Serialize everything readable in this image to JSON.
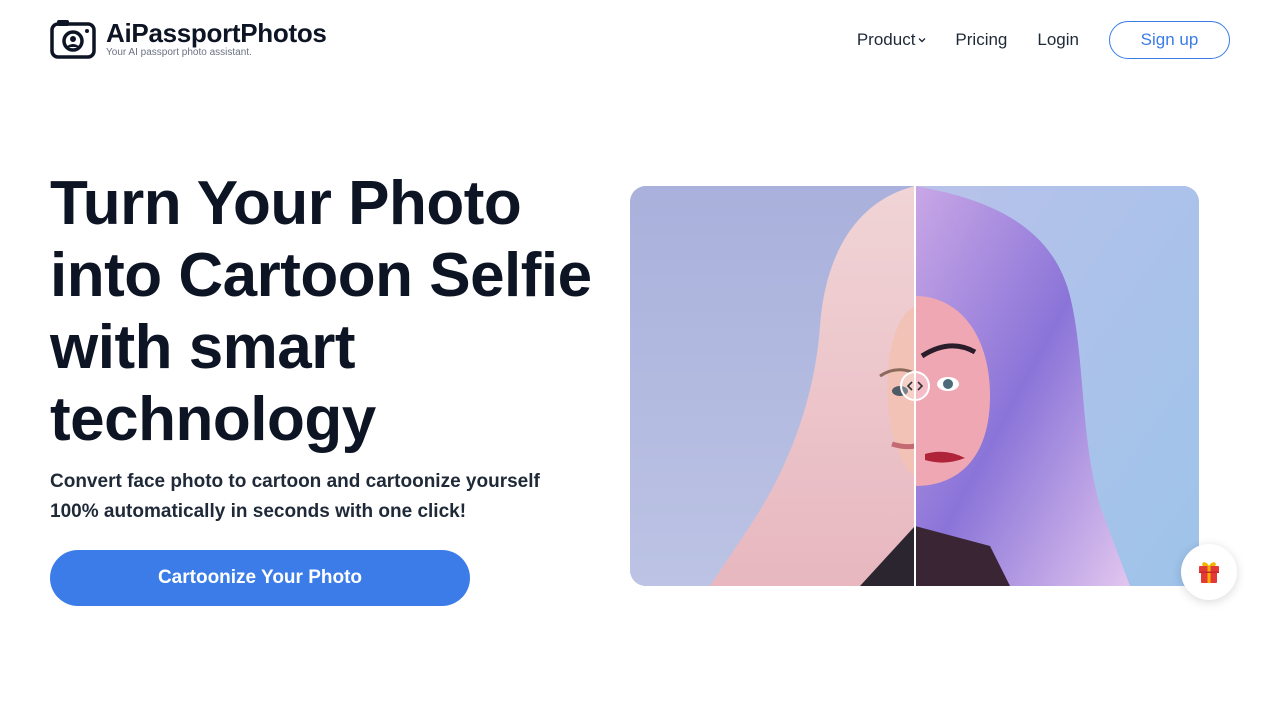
{
  "brand": {
    "name": "AiPassportPhotos",
    "tagline": "Your AI passport photo assistant."
  },
  "nav": {
    "product": "Product",
    "pricing": "Pricing",
    "login": "Login",
    "signup": "Sign up"
  },
  "hero": {
    "title": "Turn Your Photo into Cartoon Selfie with smart technology",
    "subtitle": "Convert face photo to cartoon and cartoonize yourself 100% automatically in seconds with one click!",
    "cta": "Cartoonize Your Photo"
  },
  "icons": {
    "logo": "camera-icon",
    "product_dropdown": "chevron-down-icon",
    "compare_handle": "left-right-arrows-icon",
    "gift": "gift-icon"
  },
  "colors": {
    "primary": "#3b7ce8",
    "heading": "#0d1424",
    "text": "#1f2937",
    "gift_red": "#e53935",
    "gift_yellow": "#f4b400"
  }
}
